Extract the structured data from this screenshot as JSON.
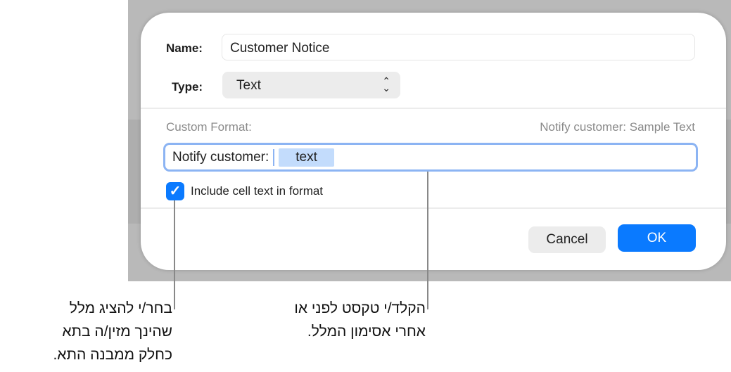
{
  "dialog": {
    "name_label": "Name:",
    "name_value": "Customer Notice",
    "type_label": "Type:",
    "type_value": "Text",
    "custom_format_label": "Custom Format:",
    "preview": "Notify customer: Sample Text",
    "format_prefix": "Notify customer:",
    "format_token": "text",
    "checkbox_label": "Include cell text in format",
    "checkbox_checked": true,
    "cancel_label": "Cancel",
    "ok_label": "OK",
    "accent": "#0a7aff"
  },
  "callouts": {
    "left": [
      "בחר/י להציג מלל",
      "שהינך מזין/ה בתא",
      "כחלק ממבנה התא."
    ],
    "right": [
      "הקלד/י טקסט לפני או",
      "אחרי אסימון המלל."
    ]
  }
}
